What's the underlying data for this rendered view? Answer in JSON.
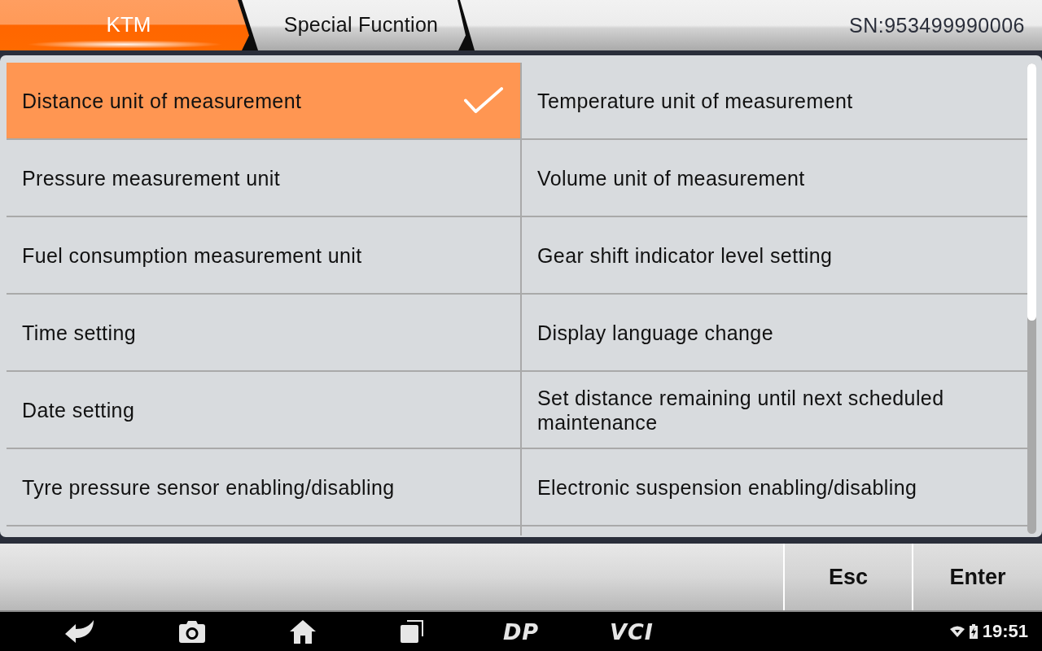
{
  "breadcrumb": [
    {
      "label": "KTM",
      "selected": true
    },
    {
      "label": "Special Fucntion",
      "selected": false
    }
  ],
  "serial": "SN:953499990006",
  "functions": [
    {
      "label": "Distance unit of measurement",
      "selected": true
    },
    {
      "label": "Temperature unit of measurement",
      "selected": false
    },
    {
      "label": "Pressure measurement unit",
      "selected": false
    },
    {
      "label": "Volume unit of measurement",
      "selected": false
    },
    {
      "label": "Fuel consumption measurement unit",
      "selected": false
    },
    {
      "label": "Gear shift indicator level setting",
      "selected": false
    },
    {
      "label": "Time setting",
      "selected": false
    },
    {
      "label": "Display language change",
      "selected": false
    },
    {
      "label": "Date setting",
      "selected": false
    },
    {
      "label": "Set distance remaining until next scheduled maintenance",
      "selected": false
    },
    {
      "label": "Tyre pressure sensor enabling/disabling",
      "selected": false
    },
    {
      "label": "Electronic suspension enabling/disabling",
      "selected": false
    }
  ],
  "actions": [
    "Esc",
    "Enter"
  ],
  "nav_bar": {
    "buttons": [
      {
        "kind": "back"
      },
      {
        "kind": "camera"
      },
      {
        "kind": "home"
      },
      {
        "kind": "recents"
      },
      {
        "kind": "label",
        "label": "DP"
      },
      {
        "kind": "label",
        "label": "VCI"
      }
    ],
    "time": "19:51"
  }
}
